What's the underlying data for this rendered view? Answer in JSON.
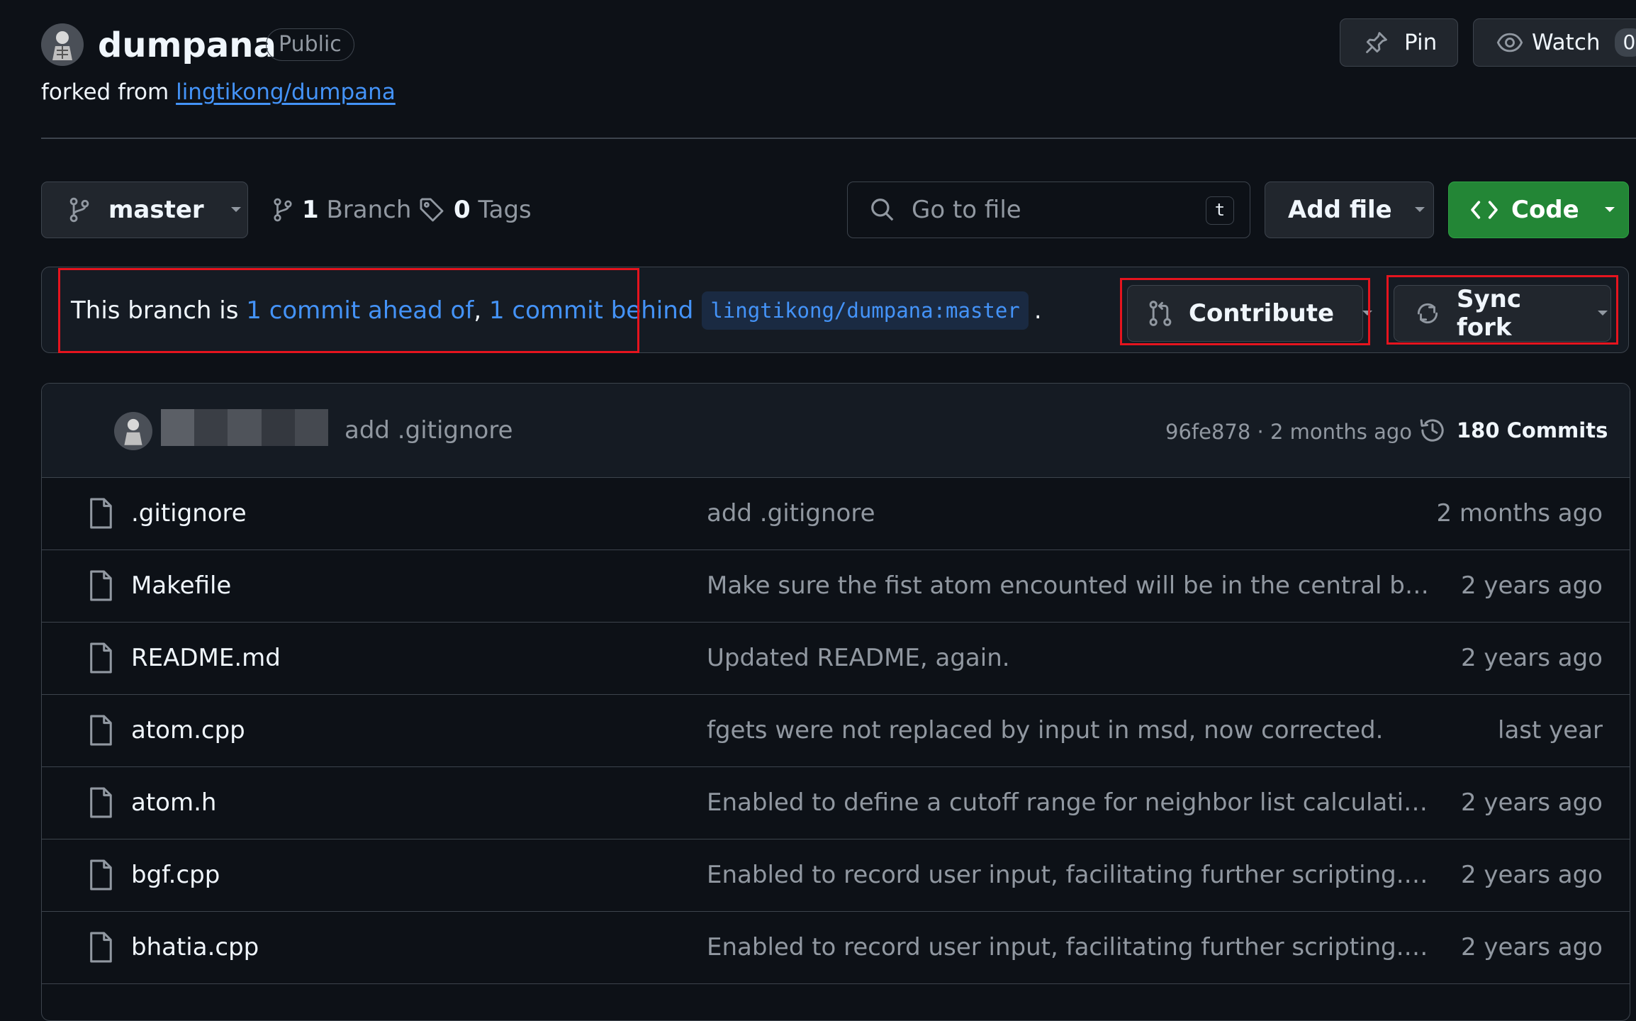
{
  "colors": {
    "background": "#0d1117",
    "accent_link": "#4493f8",
    "primary_button": "#238636",
    "highlight_box": "#e5141e"
  },
  "repo": {
    "name": "dumpana",
    "visibility": "Public",
    "forked_from_prefix": "forked from",
    "forked_from": "lingtikong/dumpana"
  },
  "header_actions": {
    "pin_label": "Pin",
    "watch_label": "Watch",
    "watch_count": "0"
  },
  "toolbar": {
    "branch_name": "master",
    "branch_count": "1",
    "branch_label": "Branch",
    "tag_count": "0",
    "tag_label": "Tags",
    "search_placeholder": "Go to file",
    "search_shortcut": "t",
    "add_file_label": "Add file",
    "code_label": "Code"
  },
  "fork_status": {
    "prefix": "This branch is ",
    "ahead": "1 commit ahead of",
    "separator": ", ",
    "behind": "1 commit behind",
    "upstream_ref": "lingtikong/dumpana:master",
    "suffix": ".",
    "contribute_label": "Contribute",
    "sync_fork_label": "Sync fork"
  },
  "latest_commit": {
    "message": "add .gitignore",
    "meta": "96fe878 · 2 months ago",
    "commits_label": "180 Commits"
  },
  "files": [
    {
      "name": ".gitignore",
      "message": "add .gitignore",
      "date": "2 months ago"
    },
    {
      "name": "Makefile",
      "message": "Make sure the fist atom encounted will be in the central box...",
      "date": "2 years ago"
    },
    {
      "name": "README.md",
      "message": "Updated README, again.",
      "date": "2 years ago"
    },
    {
      "name": "atom.cpp",
      "message": "fgets were not replaced by input in msd, now corrected.",
      "date": "last year"
    },
    {
      "name": "atom.h",
      "message": "Enabled to define a cutoff range for neighbor list calculation...",
      "date": "2 years ago"
    },
    {
      "name": "bgf.cpp",
      "message": "Enabled to record user input, facilitating further scripting. (-s...",
      "date": "2 years ago"
    },
    {
      "name": "bhatia.cpp",
      "message": "Enabled to record user input, facilitating further scripting. (-s...",
      "date": "2 years ago"
    }
  ]
}
